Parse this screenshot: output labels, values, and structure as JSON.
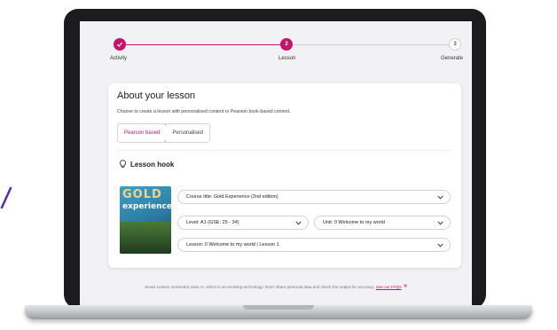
{
  "stepper": {
    "steps": [
      {
        "label": "Activity",
        "status": "complete"
      },
      {
        "label": "Lesson",
        "number": "2",
        "status": "current"
      },
      {
        "label": "Generate",
        "number": "3",
        "status": "upcoming"
      }
    ],
    "accent_color": "#c3146c"
  },
  "card": {
    "title": "About your lesson",
    "description": "Choose to create a lesson with personalised content or Pearson book-based content.",
    "tabs": [
      {
        "label": "Pearson based",
        "selected": true
      },
      {
        "label": "Personalised",
        "selected": false
      }
    ],
    "hook_label": "Lesson hook",
    "book_cover": {
      "title_line1": "GOLD",
      "title_line2": "experience"
    },
    "selects": {
      "course": "Course title: Gold Experience (2nd edition)",
      "level": "Level: A1 (GSE: 25 - 34)",
      "unit": "Unit: 0 Welcome to my world",
      "lesson": "Lesson: 0 Welcome to my world | Lesson 1"
    }
  },
  "footer": {
    "text": "Smart Lesson Generator uses AI, which is an evolving technology. Don't share personal data and check the output for accuracy.",
    "link": "See our FAQs"
  },
  "icons": [
    "check-icon",
    "lightbulb-icon",
    "chevron-down-icon",
    "external-link-icon"
  ]
}
